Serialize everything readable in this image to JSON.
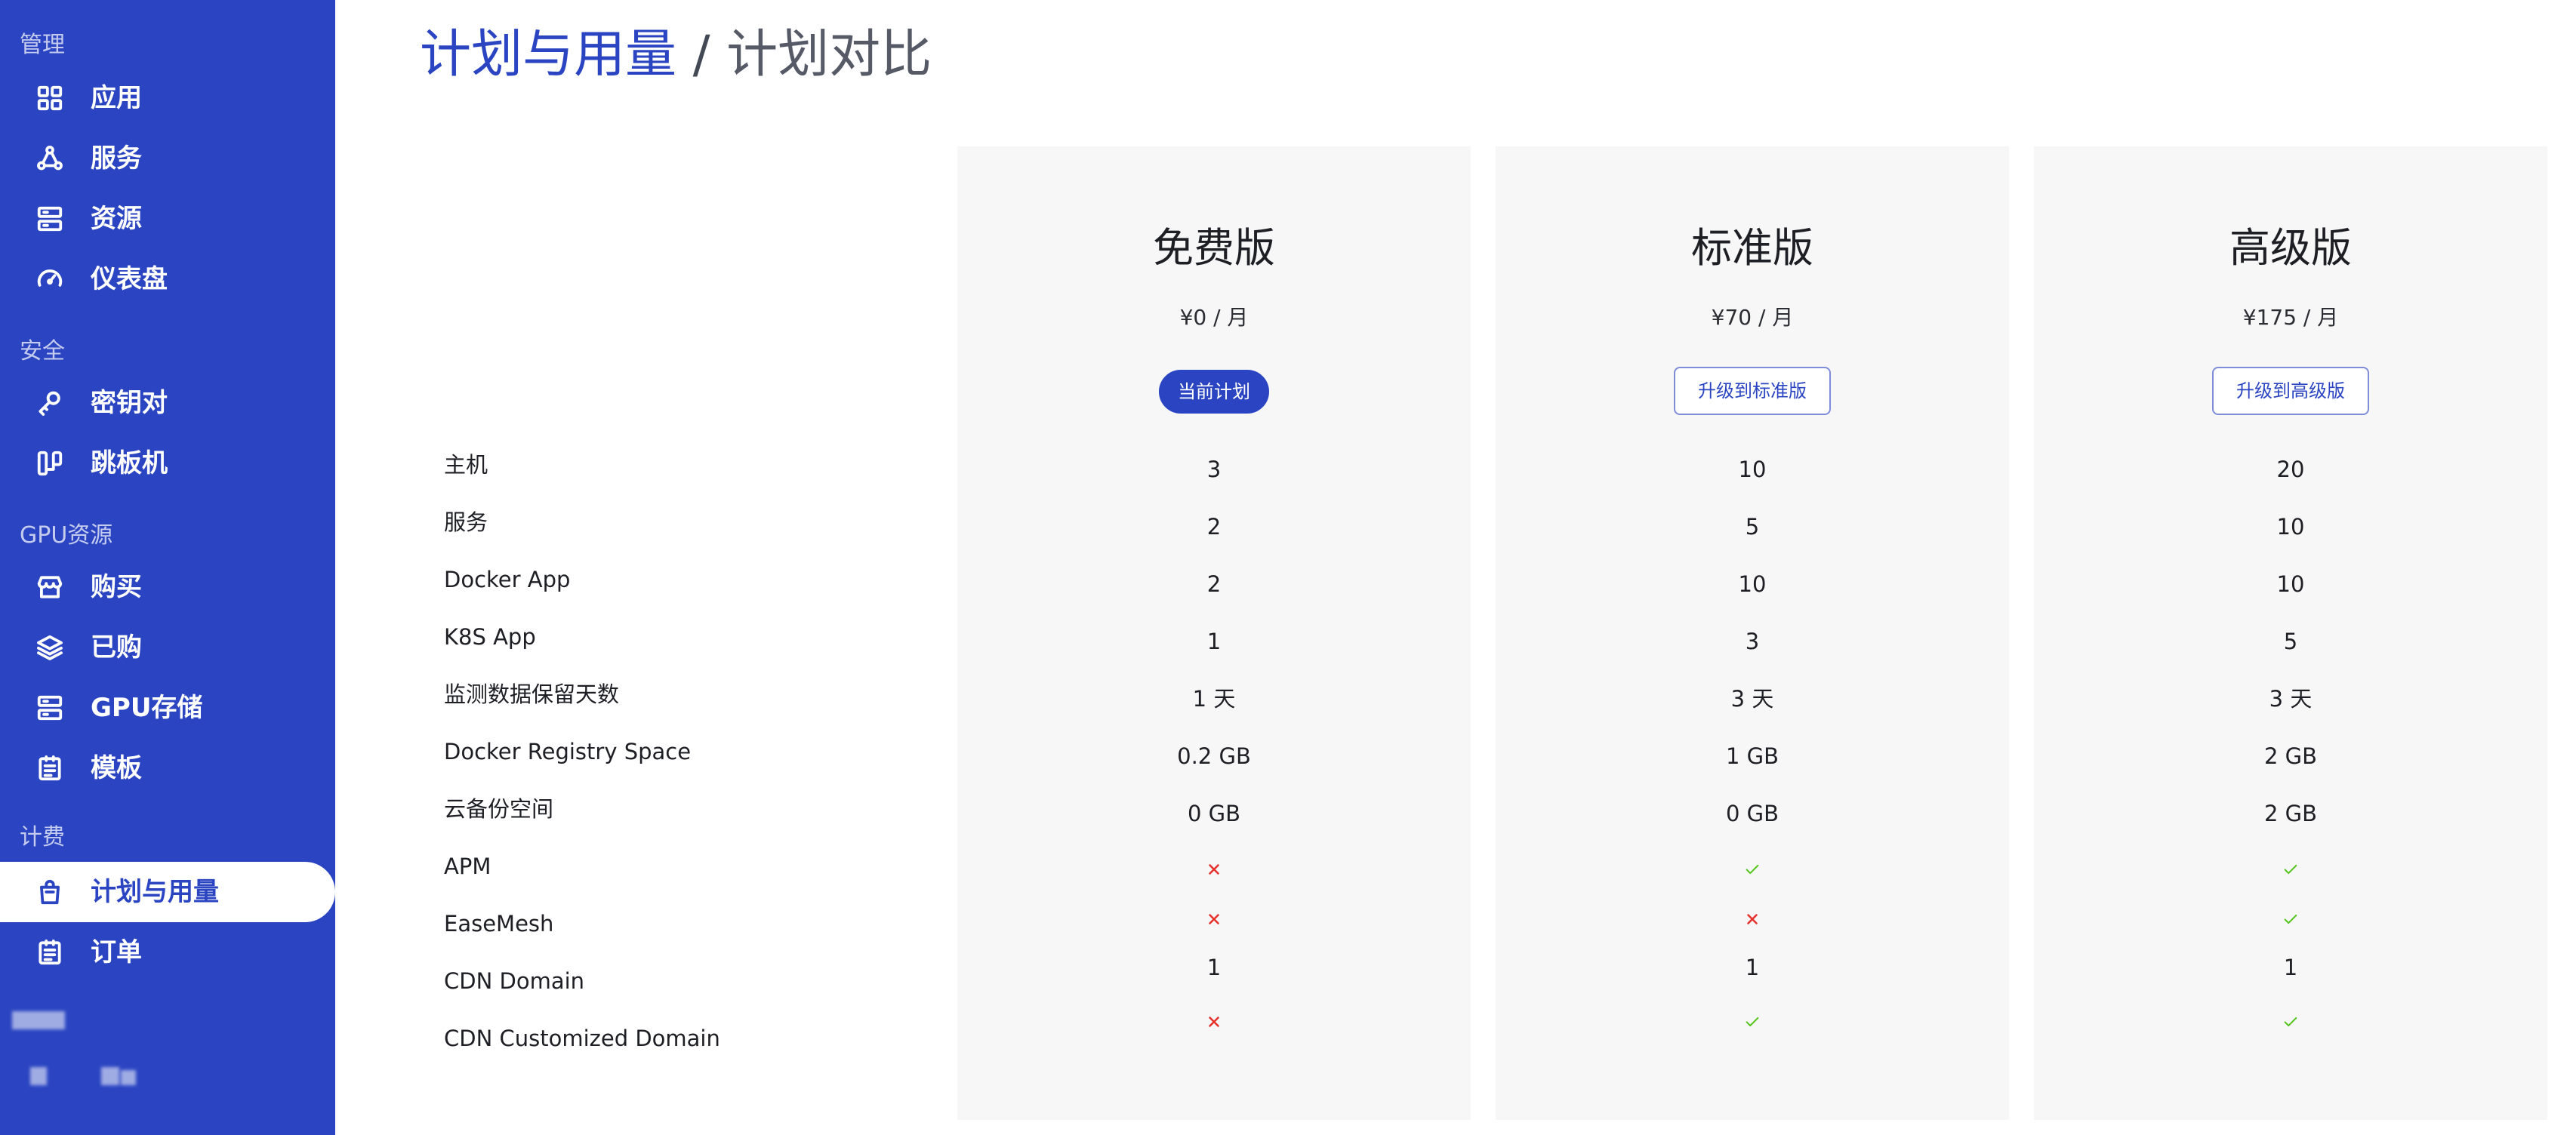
{
  "sidebar": {
    "groups": [
      {
        "label": "管理",
        "items": [
          {
            "label": "应用",
            "icon": "apps-grid-icon"
          },
          {
            "label": "服务",
            "icon": "services-icon"
          },
          {
            "label": "资源",
            "icon": "resources-icon"
          },
          {
            "label": "仪表盘",
            "icon": "dashboard-gauge-icon"
          }
        ]
      },
      {
        "label": "安全",
        "items": [
          {
            "label": "密钥对",
            "icon": "key-icon"
          },
          {
            "label": "跳板机",
            "icon": "bastion-icon"
          }
        ]
      },
      {
        "label": "GPU资源",
        "items": [
          {
            "label": "购买",
            "icon": "store-icon"
          },
          {
            "label": "已购",
            "icon": "layers-icon"
          },
          {
            "label": "GPU存储",
            "icon": "storage-icon"
          },
          {
            "label": "模板",
            "icon": "template-icon"
          }
        ]
      },
      {
        "label": "计费",
        "items": [
          {
            "label": "计划与用量",
            "icon": "shopping-bag-icon",
            "active": true
          },
          {
            "label": "订单",
            "icon": "order-icon"
          }
        ]
      }
    ]
  },
  "page": {
    "title_primary": "计划与用量",
    "title_sep": " / ",
    "title_secondary": "计划对比"
  },
  "plans": [
    {
      "name": "免费版",
      "price": "¥0 / 月",
      "button": "当前计划",
      "current": true
    },
    {
      "name": "标准版",
      "price": "¥70 / 月",
      "button": "升级到标准版",
      "current": false
    },
    {
      "name": "高级版",
      "price": "¥175 / 月",
      "button": "升级到高级版",
      "current": false
    }
  ],
  "features": [
    {
      "label": "主机",
      "values": [
        "3",
        "10",
        "20"
      ]
    },
    {
      "label": "服务",
      "values": [
        "2",
        "5",
        "10"
      ]
    },
    {
      "label": "Docker App",
      "values": [
        "2",
        "10",
        "10"
      ]
    },
    {
      "label": "K8S App",
      "values": [
        "1",
        "3",
        "5"
      ]
    },
    {
      "label": "监测数据保留天数",
      "values": [
        "1 天",
        "3 天",
        "3 天"
      ]
    },
    {
      "label": "Docker Registry Space",
      "values": [
        "0.2 GB",
        "1 GB",
        "2 GB"
      ]
    },
    {
      "label": "云备份空间",
      "values": [
        "0 GB",
        "0 GB",
        "2 GB"
      ]
    },
    {
      "label": "APM",
      "values": [
        false,
        true,
        true
      ]
    },
    {
      "label": "EaseMesh",
      "values": [
        false,
        false,
        true
      ]
    },
    {
      "label": "CDN Domain",
      "values": [
        "1",
        "1",
        "1"
      ]
    },
    {
      "label": "CDN Customized Domain",
      "values": [
        false,
        true,
        true
      ]
    }
  ],
  "colors": {
    "brand": "#2b45c2",
    "check": "#52c41a",
    "cross": "#e5322d"
  }
}
